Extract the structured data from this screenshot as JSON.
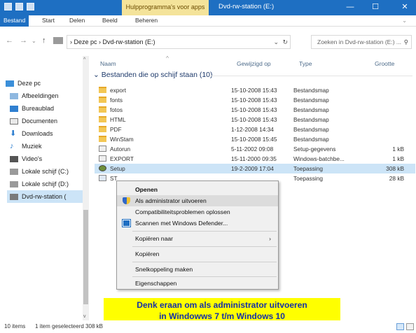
{
  "titlebar": {
    "context_tab": "Hulpprogramma's voor apps",
    "title": "Dvd-rw-station (E:)",
    "minimize": "—",
    "maximize": "☐",
    "close": "✕"
  },
  "ribbon": {
    "tabs": [
      "Bestand",
      "Start",
      "Delen",
      "Beeld",
      "Beheren"
    ]
  },
  "address": {
    "path": "› Deze pc › Dvd-rw-station (E:)",
    "search_placeholder": "Zoeken in Dvd-rw-station (E:) ..."
  },
  "sidebar": {
    "items": [
      {
        "label": "Deze pc",
        "icon": "computer-icon"
      },
      {
        "label": "Afbeeldingen",
        "icon": "pictures-icon"
      },
      {
        "label": "Bureaublad",
        "icon": "desktop-icon"
      },
      {
        "label": "Documenten",
        "icon": "documents-icon"
      },
      {
        "label": "Downloads",
        "icon": "downloads-icon"
      },
      {
        "label": "Muziek",
        "icon": "music-icon"
      },
      {
        "label": "Video's",
        "icon": "videos-icon"
      },
      {
        "label": "Lokale schijf (C:)",
        "icon": "drive-icon"
      },
      {
        "label": "Lokale schijf (D:)",
        "icon": "drive-icon"
      },
      {
        "label": "Dvd-rw-station (",
        "icon": "dvd-drive-icon"
      }
    ]
  },
  "columns": {
    "name": "Naam",
    "modified": "Gewijzigd op",
    "type": "Type",
    "size": "Grootte"
  },
  "group": {
    "header": "Bestanden die op schijf staan (10)"
  },
  "files": [
    {
      "name": "export",
      "date": "15-10-2008 15:43",
      "type": "Bestandsmap",
      "size": "",
      "kind": "folder"
    },
    {
      "name": "fonts",
      "date": "15-10-2008 15:43",
      "type": "Bestandsmap",
      "size": "",
      "kind": "folder"
    },
    {
      "name": "fotos",
      "date": "15-10-2008 15:43",
      "type": "Bestandsmap",
      "size": "",
      "kind": "folder"
    },
    {
      "name": "HTML",
      "date": "15-10-2008 15:43",
      "type": "Bestandsmap",
      "size": "",
      "kind": "folder"
    },
    {
      "name": "PDF",
      "date": "1-12-2008 14:34",
      "type": "Bestandsmap",
      "size": "",
      "kind": "folder"
    },
    {
      "name": "WinStam",
      "date": "15-10-2008 15:45",
      "type": "Bestandsmap",
      "size": "",
      "kind": "folder"
    },
    {
      "name": "Autorun",
      "date": "5-11-2002 09:08",
      "type": "Setup-gegevens",
      "size": "1 kB",
      "kind": "doc"
    },
    {
      "name": "EXPORT",
      "date": "15-11-2000 09:35",
      "type": "Windows-batchbe...",
      "size": "1 kB",
      "kind": "doc"
    },
    {
      "name": "Setup",
      "date": "19-2-2009 17:04",
      "type": "Toepassing",
      "size": "308 kB",
      "kind": "app"
    },
    {
      "name": "ST",
      "date": "",
      "type": "Toepassing",
      "size": "28 kB",
      "kind": "app"
    }
  ],
  "context_menu": {
    "items": [
      {
        "label": "Openen",
        "bold": true
      },
      {
        "label": "Als administrator uitvoeren",
        "icon": "shield-icon"
      },
      {
        "label": "Compatibiliteitsproblemen oplossen"
      },
      {
        "label": "Scannen met Windows Defender...",
        "icon": "defender-icon"
      },
      {
        "label": "Kopiëren naar",
        "submenu": true
      },
      {
        "label": "Kopiëren"
      },
      {
        "label": "Snelkoppeling maken"
      },
      {
        "label": "Eigenschappen"
      }
    ]
  },
  "banner": {
    "line1": "Denk eraan om als administrator uitvoeren",
    "line2": "in Windowws 7 t/m Windows 10"
  },
  "status": {
    "items": "10 items",
    "selection": "1 item geselecteerd  308 kB"
  },
  "colors": {
    "accent": "#1e6fc2",
    "context_tab_bg": "#f4e39a",
    "selection": "#cce4f7",
    "banner_bg": "#ffff00",
    "banner_text": "#1530a6"
  }
}
